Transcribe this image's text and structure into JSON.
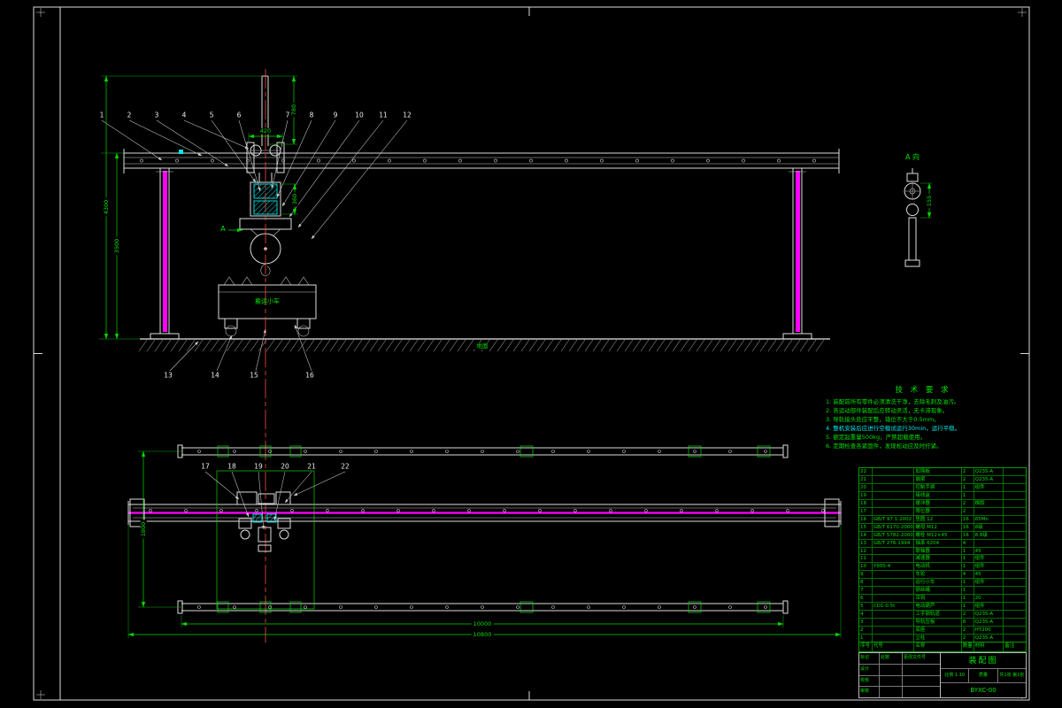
{
  "drawing": {
    "ground_label": "地面",
    "cart_label": "搬运小车",
    "section_letter": "A",
    "detail_label": "A 向"
  },
  "front_view": {
    "balloons_top": [
      "1",
      "2",
      "3",
      "4",
      "5",
      "6",
      "7",
      "8",
      "9",
      "10",
      "11",
      "12"
    ],
    "balloons_bottom": [
      "13",
      "14",
      "15",
      "16"
    ],
    "dims": {
      "overall_height": "4300",
      "rail_height": "3500",
      "mast_height": "780",
      "trolley_width": "420",
      "hoist_height": "360"
    }
  },
  "detail_view": {
    "dim": "155"
  },
  "plan_view": {
    "balloons": [
      "17",
      "18",
      "19",
      "20",
      "21",
      "22"
    ],
    "dims": {
      "gauge": "1800",
      "span": "10000",
      "overall": "10800"
    }
  },
  "tech_requirements": {
    "title": "技 术 要 求",
    "lines": [
      {
        "text": "1. 装配前所有零件必须清洗干净，去除毛刺及油污。",
        "cyan": false
      },
      {
        "text": "2. 各运动部件装配后应转动灵活，无卡滞现象。",
        "cyan": false
      },
      {
        "text": "3. 导轨接头处应平整，错位不大于0.5mm。",
        "cyan": false
      },
      {
        "text": "4. 整机安装后应进行空载试运行30min，运行平稳。",
        "cyan": true
      },
      {
        "text": "5. 额定起重量500kg，严禁超载使用。",
        "cyan": false
      },
      {
        "text": "6. 定期检查各紧固件，发现松动应及时拧紧。",
        "cyan": false
      }
    ]
  },
  "bom": {
    "headers": [
      "序号",
      "代号",
      "名称",
      "数量",
      "材料",
      "备注"
    ],
    "rows": [
      [
        "22",
        "",
        "加强板",
        "2",
        "Q235-A",
        ""
      ],
      [
        "21",
        "",
        "端梁",
        "2",
        "Q235-A",
        ""
      ],
      [
        "20",
        "",
        "控制手柄",
        "1",
        "组件",
        ""
      ],
      [
        "19",
        "",
        "接线盒",
        "1",
        "",
        ""
      ],
      [
        "18",
        "",
        "缓冲器",
        "2",
        "橡胶",
        ""
      ],
      [
        "17",
        "",
        "限位器",
        "2",
        "",
        ""
      ],
      [
        "16",
        "GB/T 97.1-2002",
        "垫圈 12",
        "16",
        "65Mn",
        ""
      ],
      [
        "15",
        "GB/T 6170-2000",
        "螺母 M12",
        "16",
        "8级",
        ""
      ],
      [
        "14",
        "GB/T 5782-2000",
        "螺栓 M12×45",
        "16",
        "8.8级",
        ""
      ],
      [
        "13",
        "GB/T 276-1994",
        "轴承 6204",
        "4",
        "",
        ""
      ],
      [
        "12",
        "",
        "联轴器",
        "1",
        "45",
        ""
      ],
      [
        "11",
        "",
        "减速器",
        "1",
        "组件",
        ""
      ],
      [
        "10",
        "Y90S-4",
        "电动机",
        "1",
        "组件",
        ""
      ],
      [
        "9",
        "",
        "车轮",
        "4",
        "45",
        ""
      ],
      [
        "8",
        "",
        "运行小车",
        "1",
        "组件",
        ""
      ],
      [
        "7",
        "",
        "钢丝绳",
        "1",
        "",
        ""
      ],
      [
        "6",
        "",
        "吊钩",
        "1",
        "20",
        ""
      ],
      [
        "5",
        "CD1-0.5t",
        "电动葫芦",
        "1",
        "组件",
        ""
      ],
      [
        "4",
        "",
        "工字钢轨道",
        "2",
        "Q235-A",
        ""
      ],
      [
        "3",
        "",
        "导轨压板",
        "8",
        "Q235-A",
        ""
      ],
      [
        "2",
        "",
        "底座",
        "2",
        "HT200",
        ""
      ],
      [
        "1",
        "",
        "立柱",
        "2",
        "Q235-A",
        ""
      ]
    ]
  },
  "title_block": {
    "row1": [
      "标记",
      "处数",
      "更改文件号"
    ],
    "row2": [
      "设计",
      "",
      ""
    ],
    "row3": [
      "校核",
      "",
      ""
    ],
    "row4": [
      "审核",
      "",
      ""
    ],
    "title": "装配图",
    "scale": "比例 1:10",
    "weight": "质量",
    "sheet": "共1张 第1张",
    "drawing_no": "BYXC-00"
  }
}
